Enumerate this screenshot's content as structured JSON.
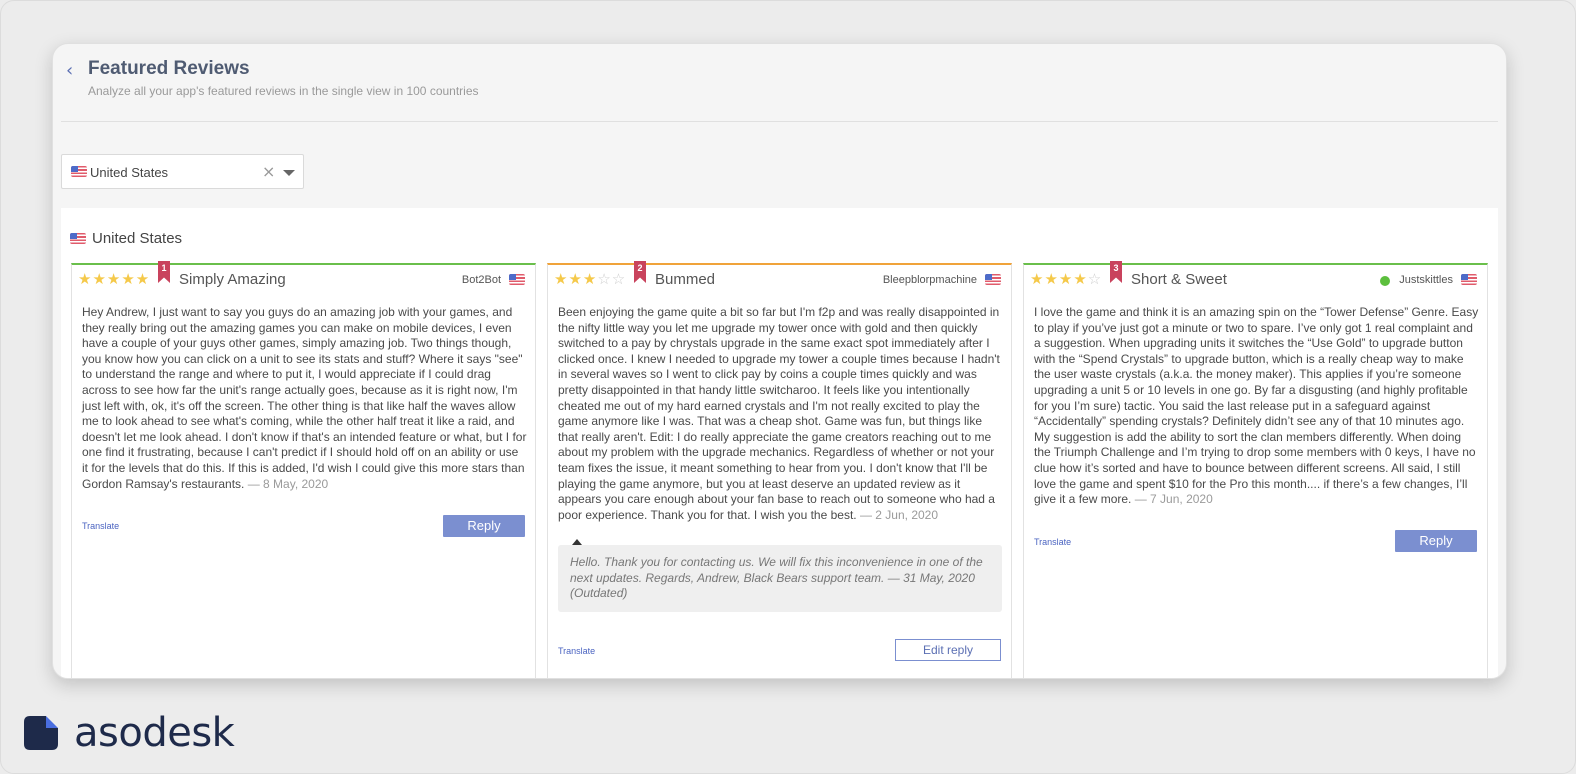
{
  "header": {
    "title": "Featured Reviews",
    "subtitle": "Analyze all your app's featured reviews in the single view in 100 countries",
    "back_icon": "‹"
  },
  "filter": {
    "selected_country": "United States",
    "clear_icon": "×"
  },
  "section": {
    "title": "United States"
  },
  "reviews": [
    {
      "rank": "1",
      "rating": 5,
      "title": "Simply Amazing",
      "author": "Bot2Bot",
      "body": "Hey Andrew, I just want to say you guys do an amazing job with your games, and they really bring out the amazing games you can make on mobile devices, I even have a couple of your guys other games, simply amazing job. Two things though, you know how you can click on a unit to see its stats and stuff? Where it says \"see\" to understand the range and where to put it, I would appreciate if I could drag across to see how far the unit's range actually goes, because as it is right now, I'm just left with, ok, it's off the screen. The other thing is that like half the waves allow me to look ahead to see what's coming, while the other half treat it like a raid, and doesn't let me look ahead. I don't know if that's an intended feature or what, but I for one find it frustrating, because I can't predict if I should hold off on an ability or use it for the levels that do this. If this is added, I'd wish I could give this more stars than Gordon Ramsay's restaurants.",
      "date": "— 8 May, 2020",
      "translate": "Translate",
      "action": "Reply"
    },
    {
      "rank": "2",
      "rating": 3,
      "title": "Bummed",
      "author": "Bleepblorpmachine",
      "body": "Been enjoying the game quite a bit so far but I'm f2p and was really disappointed in the nifty little way you let me upgrade my tower once with gold and then quickly switched to a pay by chrystals upgrade in the same exact spot immediately after I clicked once. I knew I needed to upgrade my tower a couple times because I hadn't in several waves so I went to click pay by coins a couple times quickly and was pretty disappointed in that handy little switcharoo. It feels like you intentionally cheated me out of my hard earned crystals and I'm not really excited to play the game anymore like I was. That was a cheap shot. Game was fun, but things like that really aren't. Edit: I do really appreciate the game creators reaching out to me about my problem with the upgrade mechanics. Regardless of whether or not your team fixes the issue, it meant something to hear from you. I don't know that I'll be playing the game anymore, but you at least deserve an updated review as it appears you care enough about your fan base to reach out to someone who had a poor experience. Thank you for that. I wish you the best.",
      "date": "— 2 Jun, 2020",
      "reply_text": "Hello. Thank you for contacting us. We will fix this inconvenience in one of the next updates. Regards, Andrew, Black Bears support team.",
      "reply_date": "— 31 May, 2020 (Outdated)",
      "translate": "Translate",
      "action": "Edit reply"
    },
    {
      "rank": "3",
      "rating": 4,
      "title": "Short & Sweet",
      "author": "Justskittles",
      "body": "I love the game and think it is an amazing spin on the “Tower Defense” Genre. Easy to play if you’ve just got a minute or two to spare. I’ve only got 1 real complaint and a suggestion. When upgrading units it switches the “Use Gold” to upgrade button with the “Spend Crystals” to upgrade button, which is a really cheap way to make the user waste crystals (a.k.a. the money maker). This applies if you’re someone upgrading a unit 5 or 10 levels in one go. By far a disgusting (and highly profitable for you I’m sure) tactic. You said the last release put in a safeguard against “Accidentally” spending crystals? Definitely didn’t see any of that 10 minutes ago. My suggestion is add the ability to sort the clan members differently. When doing the Triumph Challenge and I’m trying to drop some members with 0 keys, I have no clue how it’s sorted and have to bounce between different screens. All said, I still love the game and spent $10 for the Pro this month.... if there’s a few changes, I’ll give it a few more.",
      "date": "— 7 Jun, 2020",
      "translate": "Translate",
      "action": "Reply"
    }
  ],
  "brand": {
    "name": "asodesk"
  },
  "colors": {
    "accent": "#7b8fd0",
    "rating_positive": "#6abf4b",
    "rating_neutral": "#f0a33a",
    "rank_badge": "#c9435d",
    "star": "#f5c94a"
  }
}
